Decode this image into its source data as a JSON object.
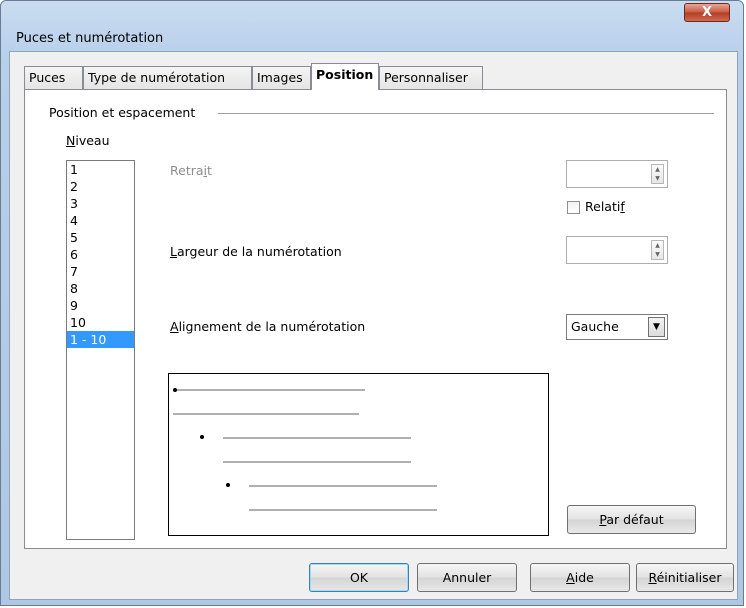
{
  "window": {
    "title": "Puces et numérotation",
    "close_label": "X"
  },
  "tabs": [
    {
      "label": "Puces",
      "active": false
    },
    {
      "label": "Type de numérotation",
      "active": false
    },
    {
      "label": "Images",
      "active": false
    },
    {
      "label": "Position",
      "active": true
    },
    {
      "label": "Personnaliser",
      "active": false
    }
  ],
  "section": {
    "title": "Position et espacement"
  },
  "level": {
    "label_first": "N",
    "label_rest": "iveau",
    "items": [
      "1",
      "2",
      "3",
      "4",
      "5",
      "6",
      "7",
      "8",
      "9",
      "10",
      "1 - 10"
    ],
    "selected": "1 - 10"
  },
  "indent": {
    "label_pre": "Retra",
    "label_u": "i",
    "label_post": "t",
    "value": ""
  },
  "relative": {
    "label_pre": "Relati",
    "label_u": "f",
    "checked": false
  },
  "numbering_width": {
    "label_first": "L",
    "label_rest": "argeur de la numérotation",
    "value": ""
  },
  "numbering_alignment": {
    "label_first": "A",
    "label_rest": "lignement de la numérotation",
    "selected": "Gauche"
  },
  "buttons": {
    "default": {
      "label_first": "P",
      "label_rest": "ar défaut"
    },
    "ok": "OK",
    "cancel": "Annuler",
    "help": {
      "label_first": "A",
      "label_rest": "ide"
    },
    "reset": {
      "label_first": "R",
      "label_rest": "éinitialiser"
    }
  },
  "colors": {
    "selection": "#3399ff",
    "dialog_bg": "#f0f0f0"
  }
}
